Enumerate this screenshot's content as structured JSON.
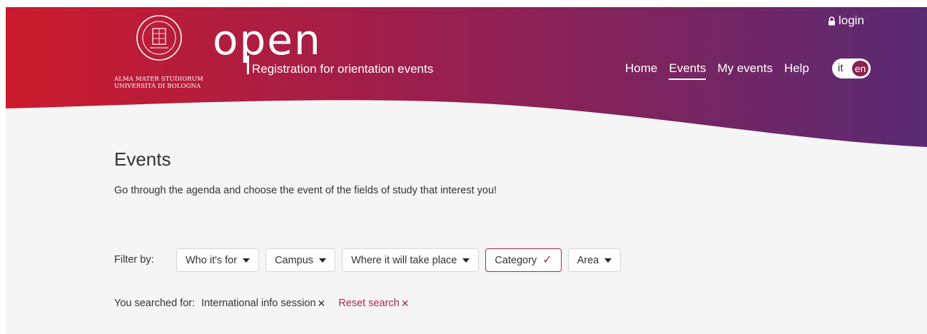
{
  "logo": {
    "line1": "ALMA MATER STUDIORUM",
    "line2": "UNIVERSITÀ DI BOLOGNA"
  },
  "brand": {
    "title": "open",
    "subtitle": "Registration for orientation events"
  },
  "header": {
    "login_label": "login",
    "nav": [
      {
        "label": "Home"
      },
      {
        "label": "Events"
      },
      {
        "label": "My events"
      },
      {
        "label": "Help"
      }
    ],
    "active_nav": "Events",
    "lang": {
      "it": "it",
      "en": "en",
      "selected": "en"
    }
  },
  "main": {
    "title": "Events",
    "intro": "Go through the agenda and choose the event of the fields of study that interest you!",
    "filter_label": "Filter by:",
    "filters": [
      {
        "label": "Who it's for",
        "selected": false
      },
      {
        "label": "Campus",
        "selected": false
      },
      {
        "label": "Where it will take place",
        "selected": false
      },
      {
        "label": "Category",
        "selected": true
      },
      {
        "label": "Area",
        "selected": false
      }
    ],
    "search_label": "You searched for:",
    "search_term": "International info session",
    "reset_label": "Reset search"
  },
  "colors": {
    "gradient_start": "#c91a2e",
    "gradient_mid": "#9e2050",
    "gradient_end": "#5a2a72",
    "accent": "#a8294f",
    "background": "#f5f5f5"
  },
  "icons": [
    "lock-icon",
    "caret-down-icon",
    "check-icon",
    "close-icon",
    "university-seal-icon"
  ]
}
